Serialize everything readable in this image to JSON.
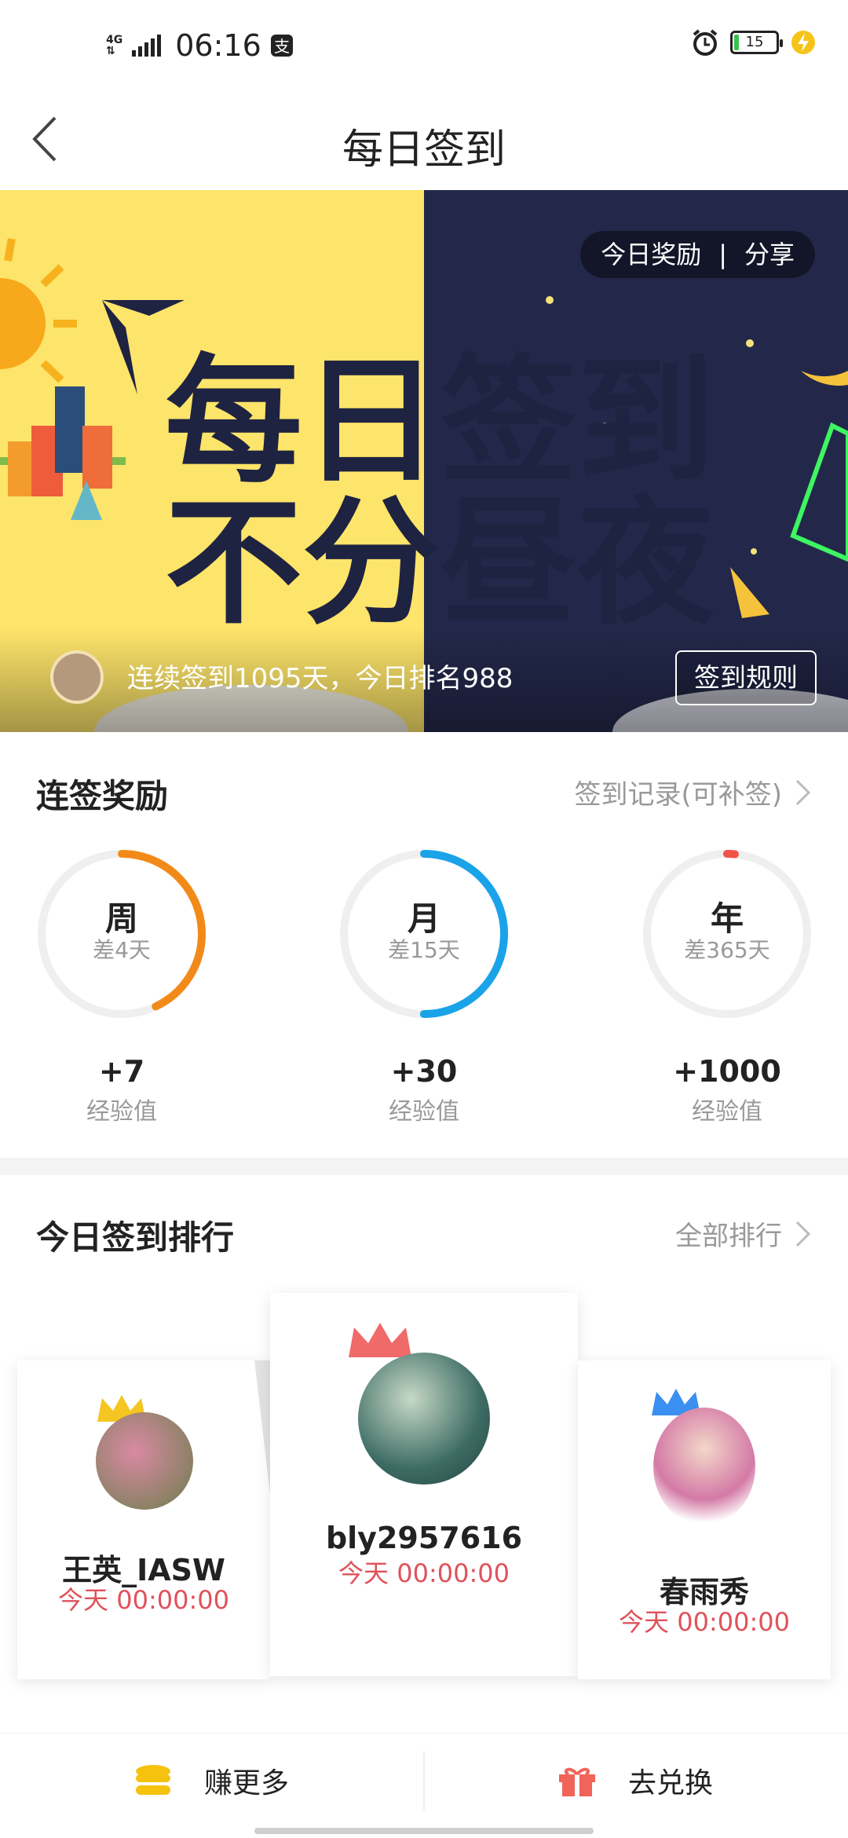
{
  "status_bar": {
    "network": "4G",
    "time": "06:16",
    "battery": "15"
  },
  "header": {
    "title": "每日签到"
  },
  "banner": {
    "headline_line1": "每日签到",
    "headline_line2": "不分昼夜",
    "actions": {
      "reward": "今日奖励",
      "separator": "|",
      "share": "分享"
    },
    "streak_text": "连续签到1095天，今日排名988",
    "rules_button": "签到规则"
  },
  "streak_rewards": {
    "title": "连签奖励",
    "record_link": "签到记录(可补签)",
    "items": [
      {
        "period": "周",
        "remaining": "差4天",
        "progress": 0.43,
        "color": "#f28a1a",
        "reward": "+7",
        "reward_unit": "经验值"
      },
      {
        "period": "月",
        "remaining": "差15天",
        "progress": 0.5,
        "color": "#1aa3e8",
        "reward": "+30",
        "reward_unit": "经验值"
      },
      {
        "period": "年",
        "remaining": "差365天",
        "progress": 0.01,
        "color": "#f05348",
        "reward": "+1000",
        "reward_unit": "经验值"
      }
    ]
  },
  "ranking": {
    "title": "今日签到排行",
    "all_link": "全部排行",
    "entries": [
      {
        "rank": 2,
        "name": "王英_IASW",
        "time": "今天 00:00:00",
        "crown_color": "#f5c522"
      },
      {
        "rank": 1,
        "name": "bly2957616",
        "time": "今天 00:00:00",
        "crown_color": "#f06a6a"
      },
      {
        "rank": 3,
        "name": "春雨秀",
        "time": "今天 00:00:00",
        "crown_color": "#3a8ff0"
      }
    ]
  },
  "bottom_bar": {
    "earn": "赚更多",
    "exchange": "去兑换"
  }
}
